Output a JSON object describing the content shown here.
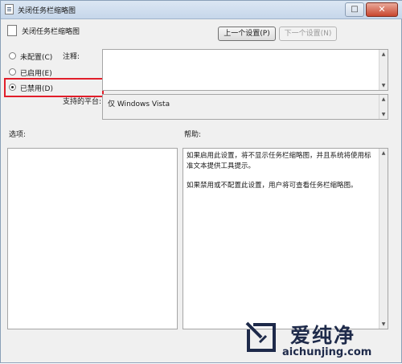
{
  "window": {
    "title": "关闭任务栏缩略图",
    "close_glyph": "✕",
    "maximize_glyph": "□"
  },
  "header": {
    "policy_title": "关闭任务栏缩略图",
    "prev_button": "上一个设置(P)",
    "next_button": "下一个设置(N)"
  },
  "state": {
    "options": [
      {
        "label": "未配置(C)",
        "checked": false
      },
      {
        "label": "已启用(E)",
        "checked": false
      },
      {
        "label": "已禁用(D)",
        "checked": true
      }
    ]
  },
  "comment": {
    "label": "注释:",
    "value": ""
  },
  "supported": {
    "label": "支持的平台:",
    "value": "仅 Windows Vista"
  },
  "options_panel": {
    "label": "选项:"
  },
  "help_panel": {
    "label": "帮助:",
    "paragraph1": "如果启用此设置，将不显示任务栏缩略图，并且系统将使用标准文本提供工具提示。",
    "paragraph2": "如果禁用或不配置此设置，用户将可查看任务栏缩略图。"
  },
  "watermark": {
    "brand": "爱纯净",
    "url": "aichunjing.com"
  },
  "colors": {
    "highlight": "#e11e2a",
    "watermark": "#1e2a4a"
  }
}
